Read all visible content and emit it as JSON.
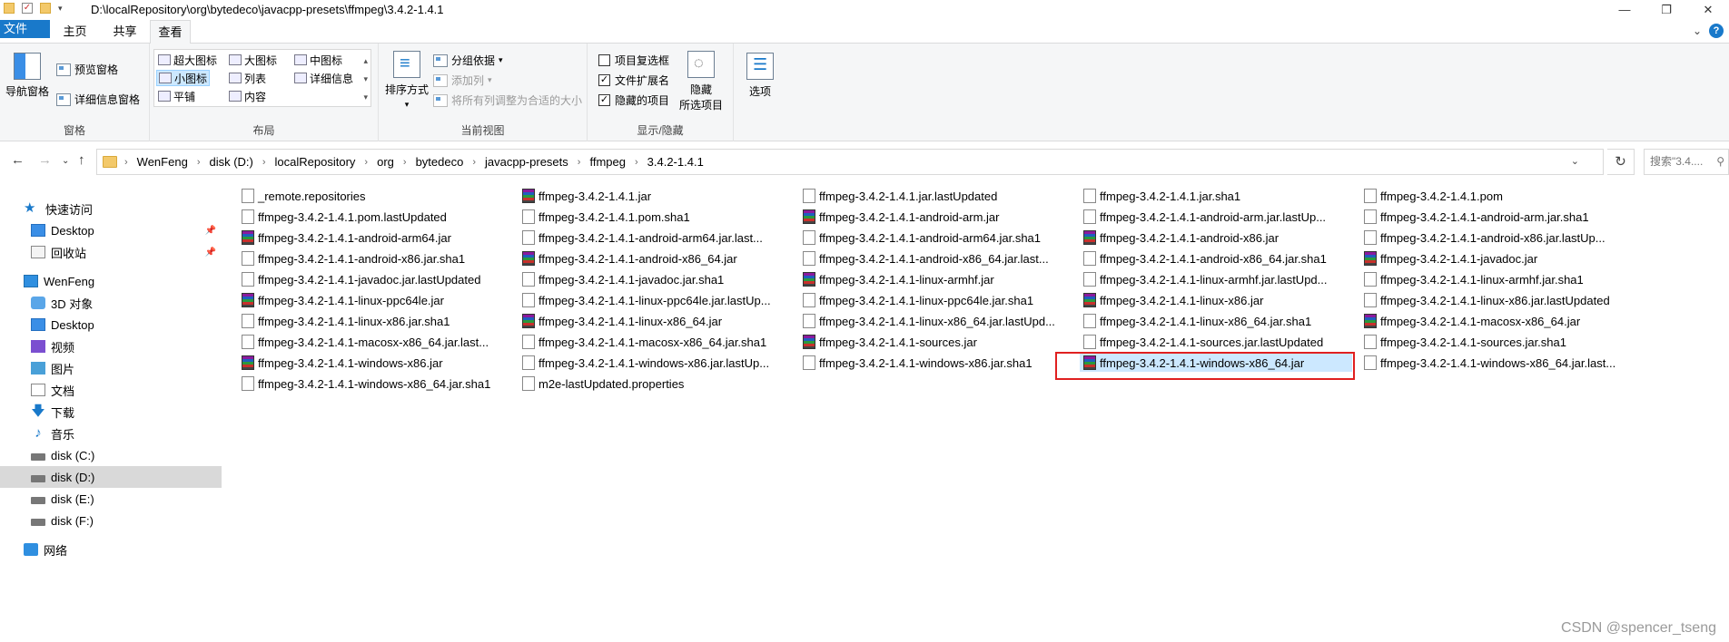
{
  "titlebar": {
    "path": "D:\\localRepository\\org\\bytedeco\\javacpp-presets\\ffmpeg\\3.4.2-1.4.1",
    "icons": [
      "folder-icon",
      "properties-icon",
      "new-folder-icon",
      "customize-icon"
    ],
    "minimize": "—",
    "maximize": "❐",
    "close": "✕"
  },
  "ribbon_tabs": {
    "file": "文件",
    "home": "主页",
    "share": "共享",
    "view": "查看"
  },
  "ribbon": {
    "panes": {
      "nav_pane": "导航窗格",
      "preview_pane": "预览窗格",
      "details_pane": "详细信息窗格",
      "label": "窗格"
    },
    "layout": {
      "extra_large": "超大图标",
      "large": "大图标",
      "medium": "中图标",
      "small": "小图标",
      "list": "列表",
      "details": "详细信息",
      "tiles": "平铺",
      "content": "内容",
      "selected": "小图标",
      "label": "布局"
    },
    "current_view": {
      "sort_by": "排序方式",
      "group_by": "分组依据",
      "add_columns": "添加列",
      "size_all_columns": "将所有列调整为合适的大小",
      "label": "当前视图"
    },
    "show_hide": {
      "item_checkboxes": "项目复选框",
      "item_checkboxes_checked": false,
      "file_extensions": "文件扩展名",
      "file_extensions_checked": true,
      "hidden_items": "隐藏的项目",
      "hidden_items_checked": true,
      "hide_selected": "隐藏\n所选项目",
      "hide_line1": "隐藏",
      "hide_line2": "所选项目",
      "label": "显示/隐藏"
    },
    "options": "选项"
  },
  "address": {
    "crumbs": [
      "WenFeng",
      "disk (D:)",
      "localRepository",
      "org",
      "bytedeco",
      "javacpp-presets",
      "ffmpeg",
      "3.4.2-1.4.1"
    ],
    "search_placeholder": "搜索\"3.4....",
    "search_icon": "search-icon"
  },
  "sidebar": {
    "items": [
      {
        "label": "快速访问",
        "icon": "star-icon"
      },
      {
        "label": "Desktop",
        "icon": "desktop-icon",
        "pinned": true
      },
      {
        "label": "回收站",
        "icon": "recycle-bin-icon",
        "pinned": true
      },
      {
        "label": "WenFeng",
        "icon": "computer-icon"
      },
      {
        "label": "3D 对象",
        "icon": "3d-objects-icon"
      },
      {
        "label": "Desktop",
        "icon": "desktop-icon"
      },
      {
        "label": "视频",
        "icon": "video-icon"
      },
      {
        "label": "图片",
        "icon": "pictures-icon"
      },
      {
        "label": "文档",
        "icon": "documents-icon"
      },
      {
        "label": "下载",
        "icon": "download-icon"
      },
      {
        "label": "音乐",
        "icon": "music-icon"
      },
      {
        "label": "disk (C:)",
        "icon": "drive-icon"
      },
      {
        "label": "disk (D:)",
        "icon": "drive-icon",
        "selected": true
      },
      {
        "label": "disk (E:)",
        "icon": "drive-icon"
      },
      {
        "label": "disk (F:)",
        "icon": "drive-icon"
      },
      {
        "label": "网络",
        "icon": "network-icon"
      }
    ]
  },
  "files": [
    [
      "_remote.repositories",
      "ffmpeg-3.4.2-1.4.1.jar",
      "ffmpeg-3.4.2-1.4.1.jar.lastUpdated",
      "ffmpeg-3.4.2-1.4.1.jar.sha1",
      "ffmpeg-3.4.2-1.4.1.pom"
    ],
    [
      "ffmpeg-3.4.2-1.4.1.pom.lastUpdated",
      "ffmpeg-3.4.2-1.4.1.pom.sha1",
      "ffmpeg-3.4.2-1.4.1-android-arm.jar",
      "ffmpeg-3.4.2-1.4.1-android-arm.jar.lastUp...",
      "ffmpeg-3.4.2-1.4.1-android-arm.jar.sha1"
    ],
    [
      "ffmpeg-3.4.2-1.4.1-android-arm64.jar",
      "ffmpeg-3.4.2-1.4.1-android-arm64.jar.last...",
      "ffmpeg-3.4.2-1.4.1-android-arm64.jar.sha1",
      "ffmpeg-3.4.2-1.4.1-android-x86.jar",
      "ffmpeg-3.4.2-1.4.1-android-x86.jar.lastUp..."
    ],
    [
      "ffmpeg-3.4.2-1.4.1-android-x86.jar.sha1",
      "ffmpeg-3.4.2-1.4.1-android-x86_64.jar",
      "ffmpeg-3.4.2-1.4.1-android-x86_64.jar.last...",
      "ffmpeg-3.4.2-1.4.1-android-x86_64.jar.sha1",
      "ffmpeg-3.4.2-1.4.1-javadoc.jar"
    ],
    [
      "ffmpeg-3.4.2-1.4.1-javadoc.jar.lastUpdated",
      "ffmpeg-3.4.2-1.4.1-javadoc.jar.sha1",
      "ffmpeg-3.4.2-1.4.1-linux-armhf.jar",
      "ffmpeg-3.4.2-1.4.1-linux-armhf.jar.lastUpd...",
      "ffmpeg-3.4.2-1.4.1-linux-armhf.jar.sha1"
    ],
    [
      "ffmpeg-3.4.2-1.4.1-linux-ppc64le.jar",
      "ffmpeg-3.4.2-1.4.1-linux-ppc64le.jar.lastUp...",
      "ffmpeg-3.4.2-1.4.1-linux-ppc64le.jar.sha1",
      "ffmpeg-3.4.2-1.4.1-linux-x86.jar",
      "ffmpeg-3.4.2-1.4.1-linux-x86.jar.lastUpdated"
    ],
    [
      "ffmpeg-3.4.2-1.4.1-linux-x86.jar.sha1",
      "ffmpeg-3.4.2-1.4.1-linux-x86_64.jar",
      "ffmpeg-3.4.2-1.4.1-linux-x86_64.jar.lastUpd...",
      "ffmpeg-3.4.2-1.4.1-linux-x86_64.jar.sha1",
      "ffmpeg-3.4.2-1.4.1-macosx-x86_64.jar"
    ],
    [
      "ffmpeg-3.4.2-1.4.1-macosx-x86_64.jar.last...",
      "ffmpeg-3.4.2-1.4.1-macosx-x86_64.jar.sha1",
      "ffmpeg-3.4.2-1.4.1-sources.jar",
      "ffmpeg-3.4.2-1.4.1-sources.jar.lastUpdated",
      "ffmpeg-3.4.2-1.4.1-sources.jar.sha1"
    ],
    [
      "ffmpeg-3.4.2-1.4.1-windows-x86.jar",
      "ffmpeg-3.4.2-1.4.1-windows-x86.jar.lastUp...",
      "ffmpeg-3.4.2-1.4.1-windows-x86.jar.sha1",
      "ffmpeg-3.4.2-1.4.1-windows-x86_64.jar",
      "ffmpeg-3.4.2-1.4.1-windows-x86_64.jar.last..."
    ],
    [
      "ffmpeg-3.4.2-1.4.1-windows-x86_64.jar.sha1",
      "m2e-lastUpdated.properties"
    ]
  ],
  "selected_file": "ffmpeg-3.4.2-1.4.1-windows-x86_64.jar",
  "colors": {
    "accent": "#1979ca",
    "selection": "#cce8ff",
    "highlight_border": "#e02020"
  },
  "watermark": "CSDN @spencer_tseng"
}
